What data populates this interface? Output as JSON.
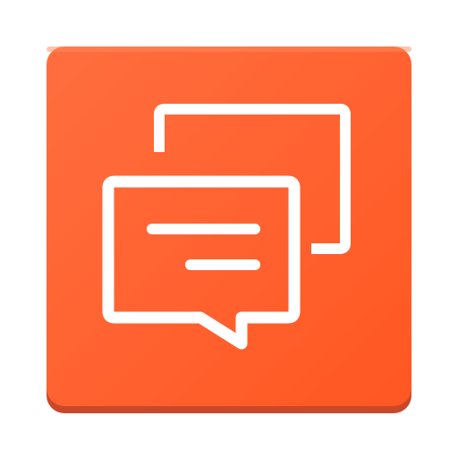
{
  "app_icon": {
    "name": "chat-messages-app-icon",
    "icon": "speech-bubbles-icon",
    "colors": {
      "background": "#FF5722",
      "background_light": "#FF6E3F",
      "edge_shadow": "#C9482A",
      "glyph": "#FFFFFF"
    }
  }
}
